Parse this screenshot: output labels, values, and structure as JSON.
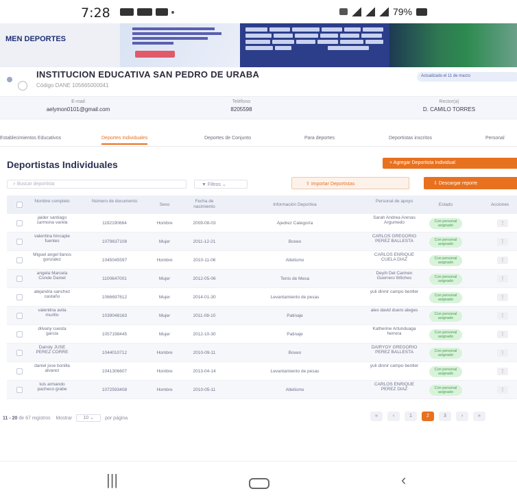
{
  "status_bar": {
    "time": "7:28",
    "battery": "79%"
  },
  "banner": {
    "logo_text": "MEN DEPORTES",
    "ad_button": "Inscríbete aquí"
  },
  "school": {
    "name": "INSTITUCION EDUCATIVA SAN PEDRO DE URABA",
    "dane": "Código DANE 105665000041",
    "chip": "Actualizado el 11 de marzo"
  },
  "info": {
    "email_label": "E-mail",
    "email_value": "aelymon0101@gmail.com",
    "phone_label": "Teléfono",
    "phone_value": "8205598",
    "rector_label": "Rector(a)",
    "rector_value": "D. CAMILO TORRES"
  },
  "tabs": [
    "Establecimientos Educativos",
    "Deportes Individuales",
    "Deportes de Conjunto",
    "Para deportes",
    "Deportistas inscritos",
    "Personal"
  ],
  "section_title": "Deportistas Individuales",
  "actions": {
    "add": "+ Agregar Deportista Individual",
    "search_placeholder": "Buscar deportista",
    "filter": "Filtros",
    "import": "Importar Deportistas",
    "download": "Descargar reporte"
  },
  "table": {
    "headers": [
      "Nombre completo",
      "Número de documento",
      "Sexo",
      "Fecha de nacimiento",
      "Información Deportiva",
      "Personal de apoyo",
      "Estado",
      "Acciones"
    ],
    "rows": [
      {
        "name": "jaider santiago carmona varela",
        "doc": "1192190664",
        "sex": "Hombre",
        "dob": "2009-08-03",
        "sport": "Ajedrez Categoría",
        "staff": "Sarah Andrea Arenas Argumedo",
        "status": "Con personal asignado"
      },
      {
        "name": "valentina hincapie fuentes",
        "doc": "1079637108",
        "sex": "Mujer",
        "dob": "2011-12-21",
        "sport": "Boxeo",
        "staff": "CARLOS GREGORIO PEREZ BALLESTA",
        "status": "Con personal asignado"
      },
      {
        "name": "Miguel angel llanos gonzalez",
        "doc": "1045045597",
        "sex": "Hombre",
        "dob": "2010-11-06",
        "sport": "Atletismo",
        "staff": "CARLOS ENRIQUE CUELA DIAZ",
        "status": "Con personal asignado"
      },
      {
        "name": "angela Marcela Conde Daniel",
        "doc": "1100647001",
        "sex": "Mujer",
        "dob": "2012-05-06",
        "sport": "Tenis de Mesa",
        "staff": "Deyih Del Carmen Guerrero Wilches",
        "status": "Con personal asignado"
      },
      {
        "name": "alejandra sanchez castaño",
        "doc": "1066697612",
        "sex": "Mujer",
        "dob": "2014-01-30",
        "sport": "Levantamiento de pesas",
        "staff": "yuli dinnir campo bentler",
        "status": "Con personal asignado"
      },
      {
        "name": "valentina avila murillo",
        "doc": "1039048163",
        "sex": "Mujer",
        "dob": "2011-08-10",
        "sport": "Patinaje",
        "staff": "alex david duero aleges",
        "status": "Con personal asignado"
      },
      {
        "name": "dilvany cuesta garcia",
        "doc": "1057198445",
        "sex": "Mujer",
        "dob": "2012-10-30",
        "sport": "Patinaje",
        "staff": "Katherine Artunduaga herrera",
        "status": "Con personal asignado"
      },
      {
        "name": "Dairoly JUSE PEREZ CORRE",
        "doc": "1044010712",
        "sex": "Hombre",
        "dob": "2010-09-11",
        "sport": "Boxeo",
        "staff": "DAIRYOY GREGORIO PEREZ BALLESTA",
        "status": "Con personal asignado"
      },
      {
        "name": "daniel jose bonilla alvarez",
        "doc": "1041306607",
        "sex": "Hombre",
        "dob": "2013-04-14",
        "sport": "Levantamiento de pesas",
        "staff": "yuli dinnir campo bentler",
        "status": "Con personal asignado"
      },
      {
        "name": "luis armando pacheco grabe",
        "doc": "1072593408",
        "sex": "Hombre",
        "dob": "2010-05-11",
        "sport": "Atletismo",
        "staff": "CARLOS ENRIQUE PEREZ DIAZ",
        "status": "Con personal asignado"
      }
    ]
  },
  "pagination": {
    "range": "11 - 20",
    "total_text": "de 67 registros",
    "show_label": "Mostrar",
    "per_page": "10",
    "per_page_label": "por página",
    "pages": [
      "«",
      "‹",
      "1",
      "2",
      "3",
      "›",
      "»"
    ],
    "current_page": "2"
  }
}
